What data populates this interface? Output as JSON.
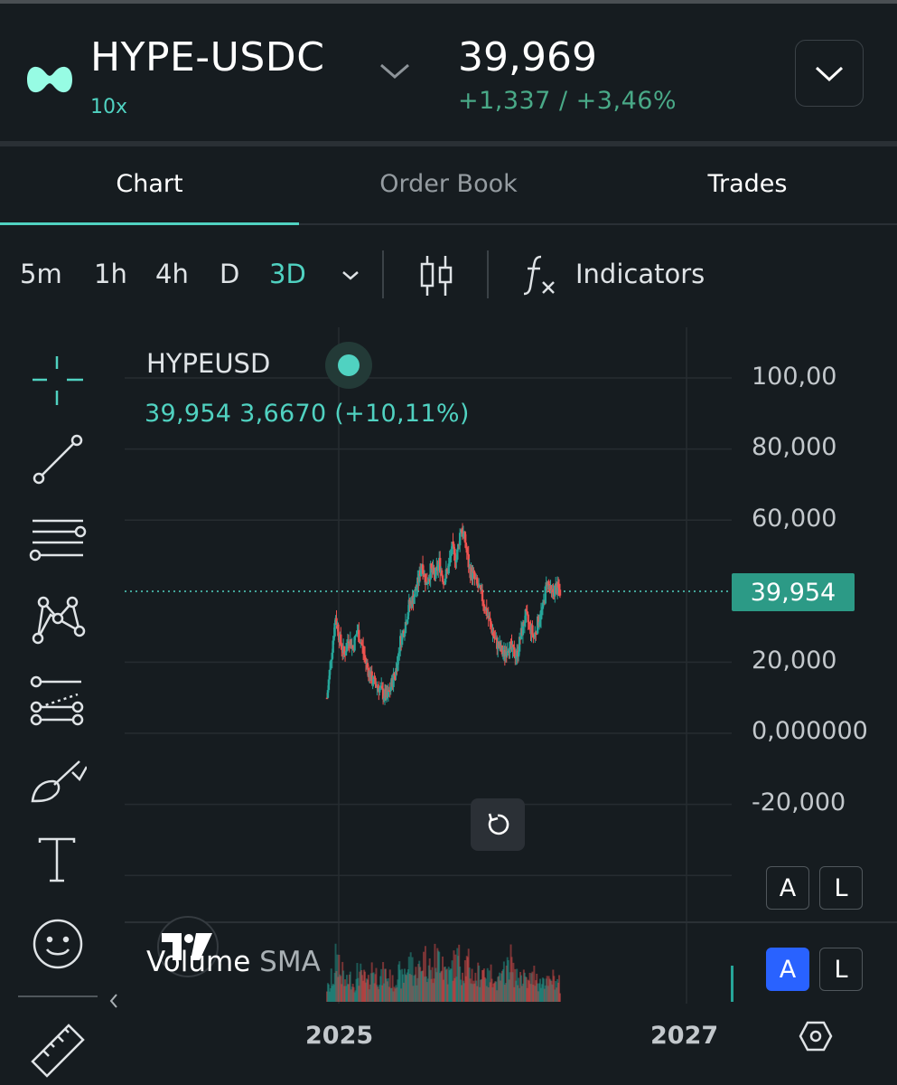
{
  "header": {
    "pair": "HYPE-USDC",
    "leverage": "10x",
    "price": "39,969",
    "change": "+1,337 / +3,46%"
  },
  "tabs": [
    {
      "label": "Chart",
      "active": true
    },
    {
      "label": "Order Book",
      "active": false
    },
    {
      "label": "Trades",
      "active": false
    }
  ],
  "toolbar": {
    "timeframes": [
      "5m",
      "1h",
      "4h",
      "D",
      "3D"
    ],
    "selected_timeframe": "3D",
    "indicators_label": "Indicators"
  },
  "legend": {
    "symbol": "HYPEUSD",
    "values": "39,954  3,6670 (+10,11%)"
  },
  "price_badge": "39,954",
  "volume_label": {
    "name": "Volume",
    "ma": "SMA"
  },
  "scale_buttons": {
    "auto": "A",
    "log": "L"
  },
  "colors": {
    "accent": "#50d2c1",
    "up": "#26a69a",
    "down": "#ef5350",
    "background": "#161c20"
  },
  "chart_data": {
    "type": "candlestick",
    "symbol": "HYPEUSD",
    "interval": "3D",
    "y_tick_labels": [
      "100,00",
      "80,000",
      "60,000",
      "40,000",
      "20,000",
      "0,000000",
      "-20,000"
    ],
    "ylim": [
      -40,
      110
    ],
    "x_tick_labels": [
      "2025",
      "2027"
    ],
    "last_price": 39.954,
    "close_series": [
      10,
      22,
      33,
      26,
      22,
      27,
      24,
      29,
      25,
      20,
      16,
      14,
      13,
      11,
      10,
      14,
      18,
      26,
      30,
      36,
      38,
      42,
      48,
      42,
      46,
      44,
      48,
      43,
      46,
      52,
      49,
      58,
      54,
      46,
      44,
      41,
      38,
      34,
      30,
      26,
      24,
      22,
      25,
      23,
      22,
      28,
      33,
      30,
      27,
      32,
      35,
      43,
      39,
      41,
      40
    ],
    "volume_series_relative": [
      0.3,
      0.5,
      0.9,
      0.6,
      0.4,
      0.5,
      0.4,
      0.6,
      0.5,
      0.4,
      0.7,
      0.6,
      0.5,
      0.6,
      0.5,
      0.4,
      0.6,
      0.5,
      0.7,
      0.8,
      0.6,
      0.7,
      0.9,
      0.8,
      0.6,
      0.9,
      1.0,
      0.7,
      0.6,
      0.8,
      0.9,
      0.7,
      0.8,
      0.6,
      0.5,
      0.6,
      0.7,
      0.5,
      0.6,
      0.4,
      0.5,
      0.7,
      0.9,
      0.6,
      0.5,
      0.6,
      0.4,
      0.5,
      0.6,
      0.4,
      0.5,
      0.4,
      0.5,
      0.4,
      0.3
    ]
  }
}
